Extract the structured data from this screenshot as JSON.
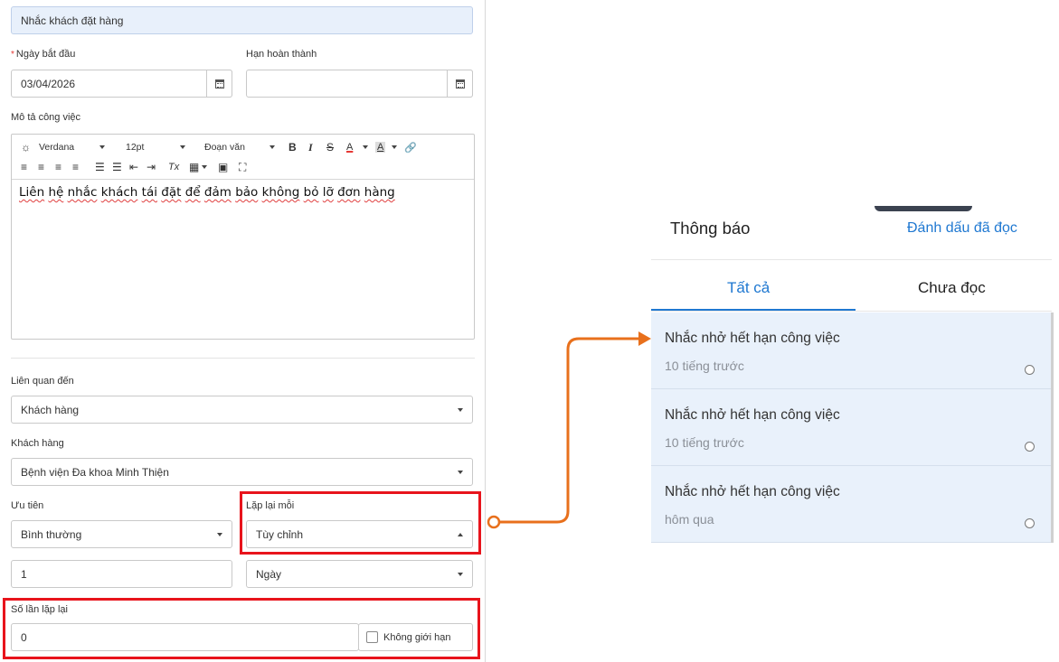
{
  "form": {
    "task_name_value": "Nhắc khách đặt hàng",
    "start_date": {
      "required_mark": "*",
      "label": "Ngày bắt đầu",
      "value": "03/04/2026",
      "icon": "calendar-icon"
    },
    "due_date": {
      "label": "Hạn hoàn thành",
      "value": "",
      "icon": "calendar-icon"
    },
    "description": {
      "label": "Mô tả công việc",
      "toolbar": {
        "font": "Verdana",
        "size": "12pt",
        "block": "Đoạn văn",
        "bold": "B",
        "italic": "I",
        "strike": "S",
        "text_color": "A",
        "bg_color": "A",
        "link": "🔗",
        "row2": [
          "≡",
          "≡",
          "≡",
          "≡",
          "☰",
          "☰",
          "⇤",
          "⇥",
          "Tx",
          "▦",
          "▣",
          "⛶"
        ]
      },
      "body_words": [
        "Liên",
        "hệ",
        "nhắc",
        "khách",
        "tái",
        "đặt",
        "để",
        "đảm",
        "bảo",
        "không",
        "bỏ",
        "lỡ",
        "đơn",
        "hàng"
      ]
    },
    "related_to": {
      "label": "Liên quan đến",
      "value": "Khách hàng"
    },
    "customer": {
      "label": "Khách hàng",
      "value": "Bệnh viện Đa khoa Minh Thiện"
    },
    "priority": {
      "label": "Ưu tiên",
      "value": "Bình thường"
    },
    "repeat_every": {
      "label": "Lặp lại mỗi",
      "value": "Tùy chỉnh"
    },
    "repeat_interval": {
      "value": "1"
    },
    "repeat_unit": {
      "value": "Ngày"
    },
    "repeat_count": {
      "label": "Số lần lặp lại",
      "value": "0",
      "unlimited_label": "Không giới hạn"
    }
  },
  "notifications": {
    "title": "Thông báo",
    "mark_all_read": "Đánh dấu đã đọc",
    "tabs": [
      {
        "label": "Tất cả",
        "active": true
      },
      {
        "label": "Chưa đọc",
        "active": false
      }
    ],
    "items": [
      {
        "title": "Nhắc nhở hết hạn công việc",
        "time": "10 tiếng trước"
      },
      {
        "title": "Nhắc nhở hết hạn công việc",
        "time": "10 tiếng trước"
      },
      {
        "title": "Nhắc nhở hết hạn công việc",
        "time": "hôm qua"
      }
    ]
  },
  "colors": {
    "highlight": "#e8141c",
    "connector": "#e8701c",
    "accent": "#1f78d1",
    "item_bg": "#e9f1fb"
  }
}
